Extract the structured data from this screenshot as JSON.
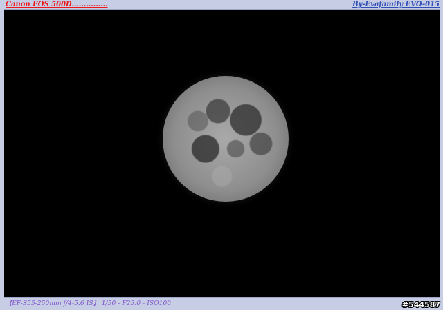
{
  "top_left_watermark": "Canon EOS 500D...............",
  "top_right_watermark": "By-Evafamily EVO-015",
  "bottom_left_caption": "【EF-S55-250mm f/4-5.6 IS】 1/50 - F25.0 - ISO100",
  "bottom_right_id": "#544587",
  "colors": {
    "frame": "#c7cde5",
    "photo_background": "#000000",
    "left_watermark": "#ea1a1a",
    "right_watermark": "#2f4fb5",
    "caption": "#7f54cb"
  },
  "image_subject": "full moon"
}
